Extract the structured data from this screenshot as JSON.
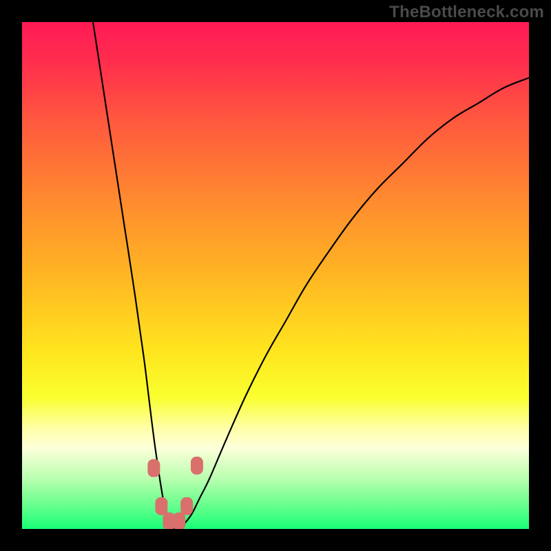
{
  "watermark": "TheBottleneck.com",
  "chart_data": {
    "type": "line",
    "title": "",
    "xlabel": "",
    "ylabel": "",
    "xlim": [
      0,
      100
    ],
    "ylim": [
      0,
      100
    ],
    "background_gradient": {
      "stops": [
        {
          "offset": 0.0,
          "color": "#ff1a55"
        },
        {
          "offset": 0.08,
          "color": "#ff2e4d"
        },
        {
          "offset": 0.2,
          "color": "#ff5a3e"
        },
        {
          "offset": 0.35,
          "color": "#ff8a2f"
        },
        {
          "offset": 0.5,
          "color": "#ffb623"
        },
        {
          "offset": 0.65,
          "color": "#ffe51e"
        },
        {
          "offset": 0.74,
          "color": "#f9ff2f"
        },
        {
          "offset": 0.8,
          "color": "#ffffa5"
        },
        {
          "offset": 0.84,
          "color": "#fdffda"
        },
        {
          "offset": 0.9,
          "color": "#baffb0"
        },
        {
          "offset": 0.95,
          "color": "#6dff8f"
        },
        {
          "offset": 1.0,
          "color": "#19ff77"
        }
      ]
    },
    "series": [
      {
        "name": "bottleneck-curve",
        "color": "#000000",
        "x": [
          14,
          16,
          18,
          20,
          22,
          24,
          25,
          26,
          27,
          28,
          28.5,
          29,
          30,
          31,
          32,
          33.5,
          35,
          37,
          40,
          44,
          48,
          52,
          56,
          60,
          65,
          70,
          75,
          80,
          85,
          90,
          95,
          100
        ],
        "y": [
          100,
          87,
          74,
          61,
          48,
          34,
          26,
          18,
          11,
          5,
          3,
          1,
          0,
          0,
          1,
          3,
          6,
          10,
          17,
          26,
          34,
          41,
          48,
          54,
          61,
          67,
          72,
          77,
          81,
          84,
          87,
          89
        ]
      }
    ],
    "markers": [
      {
        "x": 26.0,
        "y": 12.0,
        "color": "#d9706c"
      },
      {
        "x": 27.5,
        "y": 4.5,
        "color": "#d9706c"
      },
      {
        "x": 29.0,
        "y": 1.5,
        "color": "#d9706c"
      },
      {
        "x": 31.0,
        "y": 1.5,
        "color": "#d9706c"
      },
      {
        "x": 32.5,
        "y": 4.5,
        "color": "#d9706c"
      },
      {
        "x": 34.5,
        "y": 12.5,
        "color": "#d9706c"
      }
    ]
  }
}
